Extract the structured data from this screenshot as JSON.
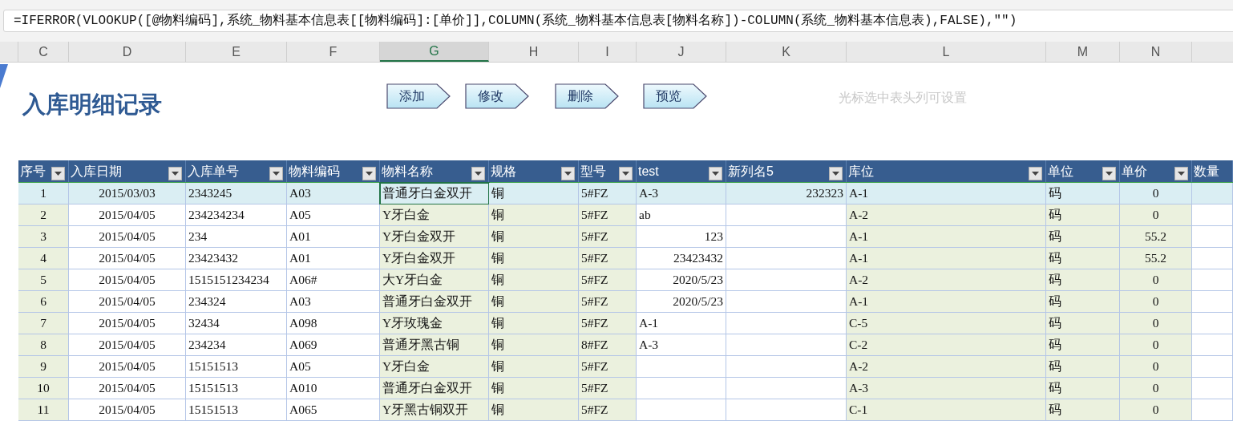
{
  "formula_bar": {
    "formula": "=IFERROR(VLOOKUP([@物料编码],系统_物料基本信息表[[物料编码]:[单价]],COLUMN(系统_物料基本信息表[物料名称])-COLUMN(系统_物料基本信息表),FALSE),\"\")"
  },
  "column_letters": [
    {
      "label": "C",
      "selected": false
    },
    {
      "label": "D",
      "selected": false
    },
    {
      "label": "E",
      "selected": false
    },
    {
      "label": "F",
      "selected": false
    },
    {
      "label": "G",
      "selected": true
    },
    {
      "label": "H",
      "selected": false
    },
    {
      "label": "I",
      "selected": false
    },
    {
      "label": "J",
      "selected": false
    },
    {
      "label": "K",
      "selected": false
    },
    {
      "label": "L",
      "selected": false
    },
    {
      "label": "M",
      "selected": false
    },
    {
      "label": "N",
      "selected": false
    }
  ],
  "title": "入库明细记录",
  "buttons": [
    "添加",
    "修改",
    "删除",
    "预览"
  ],
  "hint": "光标选中表头列可设置",
  "table": {
    "columns": [
      {
        "label": "序号",
        "filter": true,
        "shaded": true
      },
      {
        "label": "入库日期",
        "filter": true,
        "shaded": false
      },
      {
        "label": "入库单号",
        "filter": true,
        "shaded": false
      },
      {
        "label": "物料编码",
        "filter": true,
        "shaded": false
      },
      {
        "label": "物料名称",
        "filter": true,
        "shaded": true
      },
      {
        "label": "规格",
        "filter": true,
        "shaded": true
      },
      {
        "label": "型号",
        "filter": true,
        "shaded": true
      },
      {
        "label": "test",
        "filter": true,
        "shaded": false
      },
      {
        "label": "新列名5",
        "filter": true,
        "shaded": false
      },
      {
        "label": "库位",
        "filter": true,
        "shaded": true
      },
      {
        "label": "单位",
        "filter": true,
        "shaded": true
      },
      {
        "label": "单价",
        "filter": true,
        "shaded": true
      },
      {
        "label": "数量",
        "filter": false,
        "shaded": false
      }
    ],
    "rows": [
      {
        "selected": true,
        "cells": [
          "1",
          "2015/03/03",
          "2343245",
          "A03",
          "普通牙白金双开",
          "铜",
          "5#FZ",
          "A-3",
          "232323",
          "A-1",
          "码",
          "0",
          ""
        ]
      },
      {
        "selected": false,
        "cells": [
          "2",
          "2015/04/05",
          "234234234",
          "A05",
          "Y牙白金",
          "铜",
          "5#FZ",
          "ab",
          "",
          "A-2",
          "码",
          "0",
          ""
        ]
      },
      {
        "selected": false,
        "cells": [
          "3",
          "2015/04/05",
          "234",
          "A01",
          "Y牙白金双开",
          "铜",
          "5#FZ",
          "123",
          "",
          "A-1",
          "码",
          "55.2",
          ""
        ]
      },
      {
        "selected": false,
        "cells": [
          "4",
          "2015/04/05",
          "23423432",
          "A01",
          "Y牙白金双开",
          "铜",
          "5#FZ",
          "23423432",
          "",
          "A-1",
          "码",
          "55.2",
          ""
        ]
      },
      {
        "selected": false,
        "cells": [
          "5",
          "2015/04/05",
          "1515151234234",
          "A06#",
          "大Y牙白金",
          "铜",
          "5#FZ",
          "2020/5/23",
          "",
          "A-2",
          "码",
          "0",
          ""
        ]
      },
      {
        "selected": false,
        "cells": [
          "6",
          "2015/04/05",
          "234324",
          "A03",
          "普通牙白金双开",
          "铜",
          "5#FZ",
          "2020/5/23",
          "",
          "A-1",
          "码",
          "0",
          ""
        ]
      },
      {
        "selected": false,
        "cells": [
          "7",
          "2015/04/05",
          "32434",
          "A098",
          "Y牙玫瑰金",
          "铜",
          "5#FZ",
          "A-1",
          "",
          "C-5",
          "码",
          "0",
          ""
        ]
      },
      {
        "selected": false,
        "cells": [
          "8",
          "2015/04/05",
          "234234",
          "A069",
          "普通牙黑古铜",
          "铜",
          "8#FZ",
          "A-3",
          "",
          "C-2",
          "码",
          "0",
          ""
        ]
      },
      {
        "selected": false,
        "cells": [
          "9",
          "2015/04/05",
          "15151513",
          "A05",
          "Y牙白金",
          "铜",
          "5#FZ",
          "",
          "",
          "A-2",
          "码",
          "0",
          ""
        ]
      },
      {
        "selected": false,
        "cells": [
          "10",
          "2015/04/05",
          "15151513",
          "A010",
          "普通牙白金双开",
          "铜",
          "5#FZ",
          "",
          "",
          "A-3",
          "码",
          "0",
          ""
        ]
      },
      {
        "selected": false,
        "cells": [
          "11",
          "2015/04/05",
          "15151513",
          "A065",
          "Y牙黑古铜双开",
          "铜",
          "5#FZ",
          "",
          "",
          "C-1",
          "码",
          "0",
          ""
        ]
      }
    ]
  }
}
